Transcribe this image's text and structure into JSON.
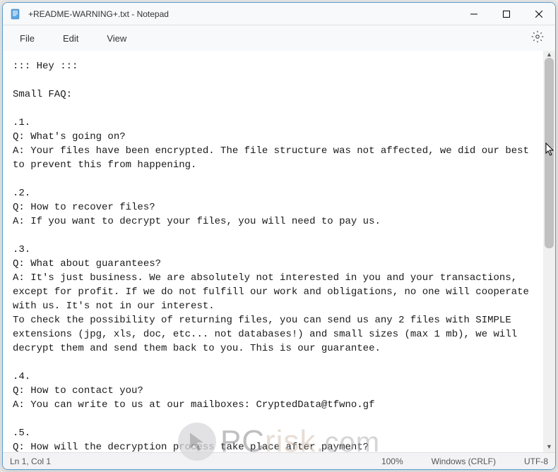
{
  "window": {
    "title": "+README-WARNING+.txt - Notepad"
  },
  "menubar": {
    "file": "File",
    "edit": "Edit",
    "view": "View"
  },
  "editor": {
    "content": "::: Hey :::\n\nSmall FAQ:\n\n.1.\nQ: What's going on?\nA: Your files have been encrypted. The file structure was not affected, we did our best to prevent this from happening.\n\n.2.\nQ: How to recover files?\nA: If you want to decrypt your files, you will need to pay us.\n\n.3.\nQ: What about guarantees?\nA: It's just business. We are absolutely not interested in you and your transactions, except for profit. If we do not fulfill our work and obligations, no one will cooperate with us. It's not in our interest.\nTo check the possibility of returning files, you can send us any 2 files with SIMPLE extensions (jpg, xls, doc, etc... not databases!) and small sizes (max 1 mb), we will decrypt them and send them back to you. This is our guarantee.\n\n.4.\nQ: How to contact you?\nA: You can write to us at our mailboxes: CryptedData@tfwno.gf\n\n.5.\nQ: How will the decryption process take place after payment?\nA: After payment, we will send you our scanner-decoder program and detailed instructions for use. With this program you will be able to decrypt all your encrypted files."
  },
  "statusbar": {
    "position": "Ln 1, Col 1",
    "zoom": "100%",
    "lineending": "Windows (CRLF)",
    "encoding": "UTF-8"
  },
  "watermark": {
    "pc": "PC",
    "risk": "risk",
    "com": ".com"
  }
}
